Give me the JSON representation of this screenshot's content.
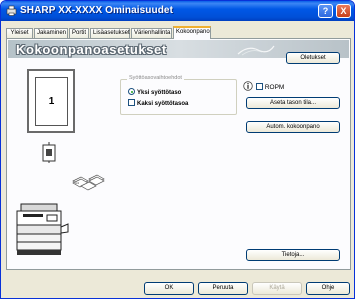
{
  "window": {
    "title": "SHARP XX-XXXX Ominaisuudet",
    "help_label": "?",
    "close_label": "X"
  },
  "tabs": [
    {
      "label": "Yleiset",
      "active": false
    },
    {
      "label": "Jakaminen",
      "active": false
    },
    {
      "label": "Portit",
      "active": false
    },
    {
      "label": "Lisäasetukset",
      "active": false
    },
    {
      "label": "Värienhallinta",
      "active": false
    },
    {
      "label": "Kokoonpano",
      "active": true
    }
  ],
  "panel": {
    "banner_title": "Kokoonpanoasetukset",
    "defaults_button": "Oletukset",
    "preview_page_number": "1",
    "group": {
      "title": "Syöttöasovaihtoehdot",
      "options": [
        {
          "label": "Yksi syöttötaso",
          "selected": true
        },
        {
          "label": "Kaksi syöttötasoa",
          "checked": false
        }
      ]
    },
    "ropm_label": "ROPM",
    "ropm_checked": false,
    "set_tray_button": "Aseta tason tila...",
    "auto_config_button": "Autom. kokoonpano",
    "info_button": "Tietoja..."
  },
  "footer": {
    "ok": "OK",
    "cancel": "Peruuta",
    "apply": "Käytä",
    "help": "Ohje"
  },
  "colors": {
    "titlebar": "#0058e6",
    "tab_highlight": "#f0b030",
    "panel_bg": "#fcfcfe",
    "dialog_bg": "#ece9d8"
  }
}
